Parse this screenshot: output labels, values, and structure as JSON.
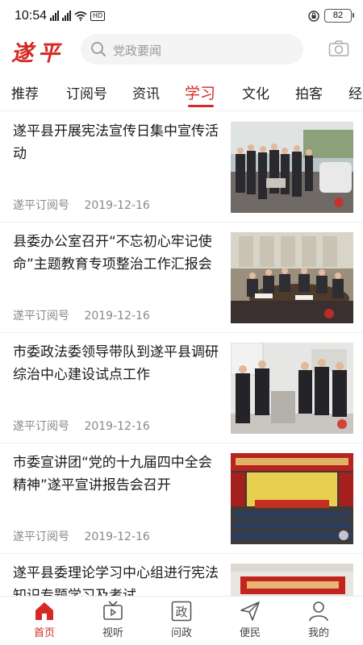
{
  "status_bar": {
    "time": "10:54",
    "hd": "HD",
    "battery": "82"
  },
  "header": {
    "logo": "遂平",
    "search_placeholder": "党政要闻"
  },
  "tabs": [
    {
      "label": "推荐"
    },
    {
      "label": "订阅号"
    },
    {
      "label": "资讯"
    },
    {
      "label": "学习"
    },
    {
      "label": "文化"
    },
    {
      "label": "拍客"
    },
    {
      "label": "经济"
    }
  ],
  "active_tab": "学习",
  "news": [
    {
      "title": "遂平县开展宪法宣传日集中宣传活动",
      "source": "遂平订阅号",
      "date": "2019-12-16"
    },
    {
      "title": "县委办公室召开“不忘初心牢记使命”主题教育专项整治工作汇报会",
      "source": "遂平订阅号",
      "date": "2019-12-16"
    },
    {
      "title": "市委政法委领导带队到遂平县调研综治中心建设试点工作",
      "source": "遂平订阅号",
      "date": "2019-12-16"
    },
    {
      "title": "市委宣讲团“党的十九届四中全会精神”遂平宣讲报告会召开",
      "source": "遂平订阅号",
      "date": "2019-12-16"
    },
    {
      "title": "遂平县委理论学习中心组进行宪法知识专题学习及考试",
      "source": "",
      "date": ""
    }
  ],
  "bottom_nav": [
    {
      "label": "首页",
      "icon": "home-icon"
    },
    {
      "label": "视听",
      "icon": "tv-icon"
    },
    {
      "label": "问政",
      "icon": "wenzheng-icon",
      "glyph": "政"
    },
    {
      "label": "便民",
      "icon": "send-icon"
    },
    {
      "label": "我的",
      "icon": "user-icon"
    }
  ],
  "colors": {
    "accent": "#d42a23"
  }
}
